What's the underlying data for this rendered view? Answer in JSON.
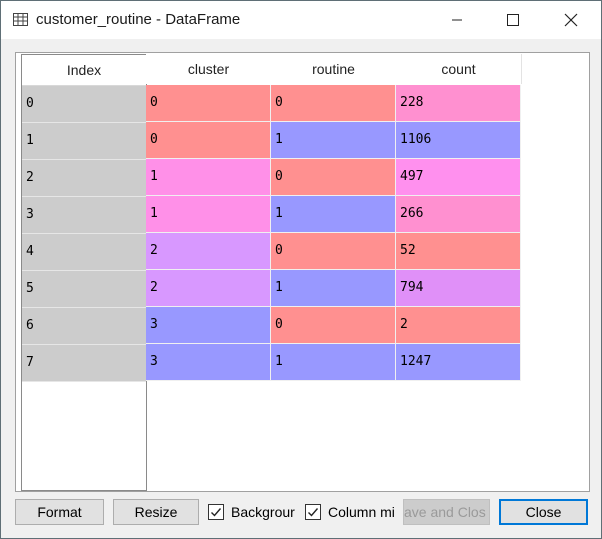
{
  "window": {
    "title": "customer_routine - DataFrame"
  },
  "table": {
    "index_header": "Index",
    "columns": [
      "cluster",
      "routine",
      "count"
    ],
    "rows": [
      {
        "index": "0",
        "cluster": "0",
        "routine": "0",
        "count": "228"
      },
      {
        "index": "1",
        "cluster": "0",
        "routine": "1",
        "count": "1106"
      },
      {
        "index": "2",
        "cluster": "1",
        "routine": "0",
        "count": "497"
      },
      {
        "index": "3",
        "cluster": "1",
        "routine": "1",
        "count": "266"
      },
      {
        "index": "4",
        "cluster": "2",
        "routine": "0",
        "count": "52"
      },
      {
        "index": "5",
        "cluster": "2",
        "routine": "1",
        "count": "794"
      },
      {
        "index": "6",
        "cluster": "3",
        "routine": "0",
        "count": "2"
      },
      {
        "index": "7",
        "cluster": "3",
        "routine": "1",
        "count": "1247"
      }
    ],
    "cell_colors": [
      [
        "#ff9090",
        "#ff9090",
        "#ff90d0"
      ],
      [
        "#ff9090",
        "#9898ff",
        "#9898ff"
      ],
      [
        "#ff90e8",
        "#ff9090",
        "#ff90ee"
      ],
      [
        "#ff90e8",
        "#9898ff",
        "#ff90d0"
      ],
      [
        "#d898ff",
        "#ff9090",
        "#ff9090"
      ],
      [
        "#d898ff",
        "#9898ff",
        "#e090f8"
      ],
      [
        "#9898ff",
        "#ff9090",
        "#ff9090"
      ],
      [
        "#9898ff",
        "#9898ff",
        "#9898ff"
      ]
    ]
  },
  "footer": {
    "format_label": "Format",
    "resize_label": "Resize",
    "background_label": "Backgrour",
    "background_checked": true,
    "column_label": "Column mi",
    "column_checked": true,
    "save_close_label": "ave and Clos",
    "close_label": "Close"
  },
  "colors": {
    "index_bg": "#cccccc",
    "accent": "#0078d7"
  }
}
